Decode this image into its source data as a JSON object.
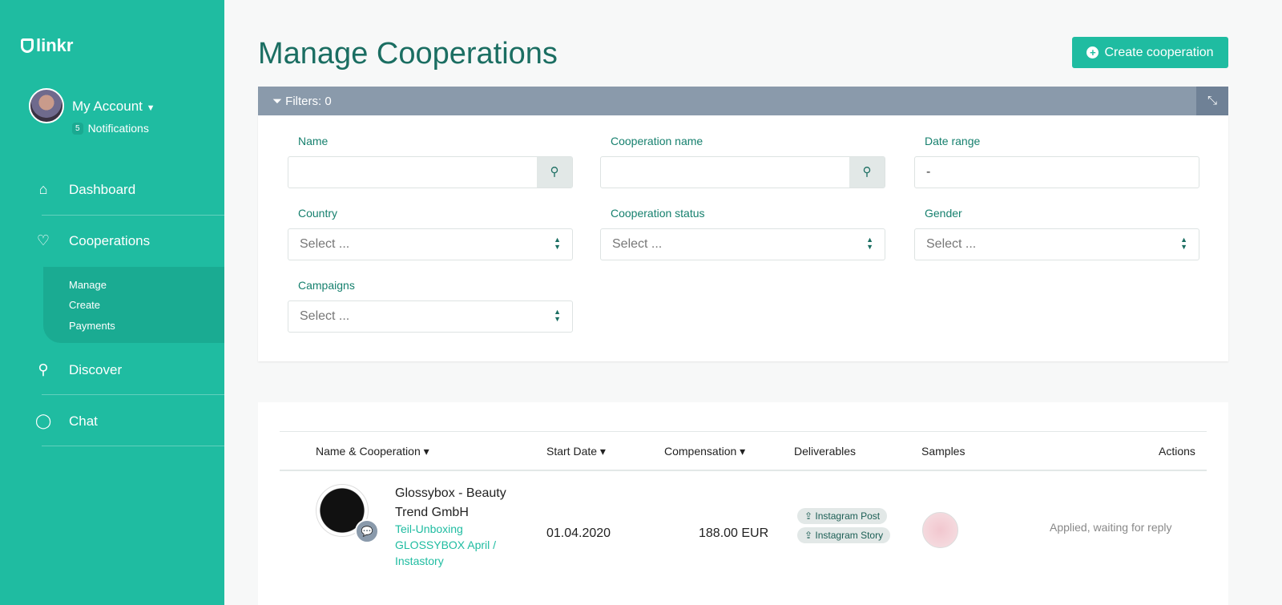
{
  "sidebar": {
    "logo": "linkr",
    "account": "My Account",
    "notif_count": "5",
    "notif_label": "Notifications",
    "nav": [
      {
        "label": "Dashboard"
      },
      {
        "label": "Cooperations"
      },
      {
        "label": "Discover"
      },
      {
        "label": "Chat"
      }
    ],
    "sub": [
      "Manage",
      "Create",
      "Payments"
    ]
  },
  "page": {
    "title": "Manage Cooperations",
    "create": "Create cooperation"
  },
  "filters": {
    "title": "Filters: 0",
    "name": "Name",
    "coop_name": "Cooperation name",
    "date_range": "Date range",
    "date_value": "-",
    "country": "Country",
    "coop_status": "Cooperation status",
    "gender": "Gender",
    "campaigns": "Campaigns",
    "select_placeholder": "Select ..."
  },
  "table": {
    "headers": [
      "Name & Cooperation",
      "Start Date",
      "Compensation",
      "Deliverables",
      "Samples",
      "Actions"
    ],
    "rows": [
      {
        "company": "Glossybox - Beauty Trend GmbH",
        "cooperation": "Teil-Unboxing GLOSSYBOX April / Instastory",
        "start": "01.04.2020",
        "compensation": "188.00 EUR",
        "deliverables": [
          "Instagram Post",
          "Instagram Story"
        ],
        "status": "Applied, waiting for reply"
      }
    ]
  }
}
